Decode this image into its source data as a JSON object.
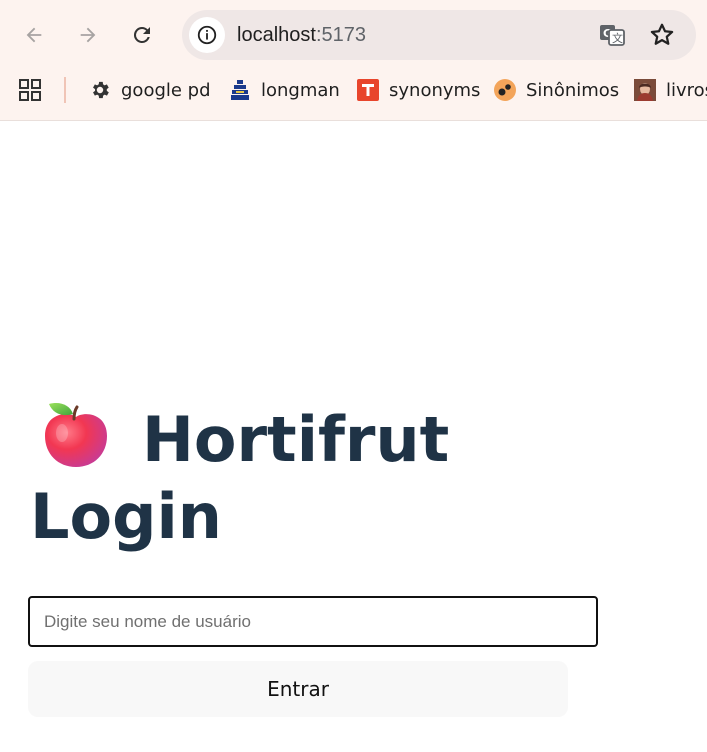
{
  "browser": {
    "address_bar": {
      "host": "localhost",
      "port": ":5173"
    },
    "bookmarks": [
      {
        "label": "google pd",
        "icon": "gear-icon"
      },
      {
        "label": "longman",
        "icon": "longman-favicon"
      },
      {
        "label": "synonyms",
        "icon": "synonyms-favicon"
      },
      {
        "label": "Sinônimos",
        "icon": "sinonimos-favicon"
      },
      {
        "label": "livros",
        "icon": "livros-favicon"
      }
    ]
  },
  "page": {
    "title_line1": "Hortifrut",
    "title_line2": "Login",
    "title_icon": "apple-icon",
    "username_placeholder": "Digite seu nome de usuário",
    "username_value": "",
    "submit_label": "Entrar"
  },
  "colors": {
    "chrome_background": "#fdf3ef",
    "heading": "#1f3346",
    "input_border": "#111111",
    "button_background": "#f8f8f8"
  }
}
